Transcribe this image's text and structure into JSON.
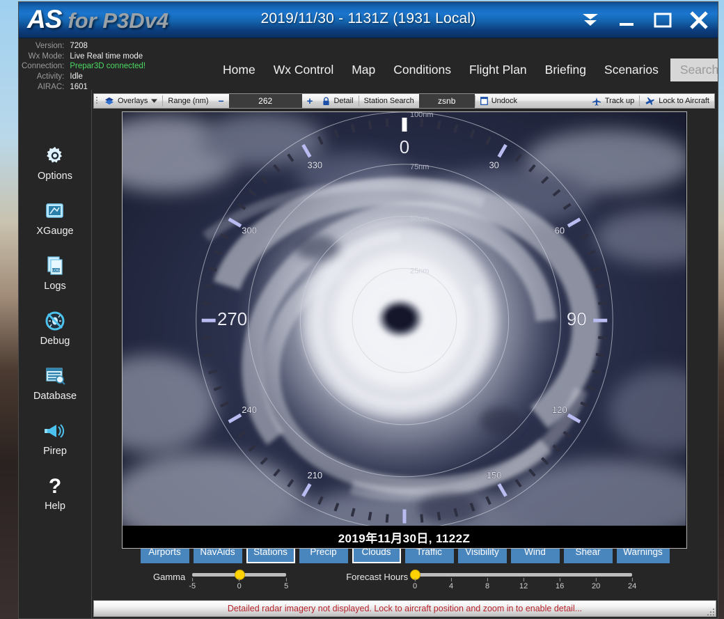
{
  "titlebar": {
    "logo_primary": "AS",
    "logo_secondary": "for P3Dv4",
    "datetime": "2019/11/30 - 1131Z (1931 Local)",
    "buttons": [
      "collapse-button",
      "minimize-button",
      "maximize-button",
      "close-button"
    ]
  },
  "status_info": [
    {
      "label": "Version:",
      "value": "7208",
      "state": "normal"
    },
    {
      "label": "Wx Mode:",
      "value": "Live Real time mode",
      "state": "normal"
    },
    {
      "label": "Connection:",
      "value": "Prepar3D connected!",
      "state": "ok"
    },
    {
      "label": "Activity:",
      "value": "Idle",
      "state": "normal"
    },
    {
      "label": "AIRAC:",
      "value": "1601",
      "state": "normal"
    }
  ],
  "nav": {
    "items": [
      "Home",
      "Wx Control",
      "Map",
      "Conditions",
      "Flight Plan",
      "Briefing",
      "Scenarios"
    ],
    "search_label": "Search"
  },
  "sidebar": {
    "items": [
      {
        "label": "Options",
        "icon": "gear-icon"
      },
      {
        "label": "XGauge",
        "icon": "gauge-icon"
      },
      {
        "label": "Logs",
        "icon": "log-document-icon"
      },
      {
        "label": "Debug",
        "icon": "debug-bug-icon"
      },
      {
        "label": "Database",
        "icon": "database-icon"
      },
      {
        "label": "Pirep",
        "icon": "megaphone-icon"
      },
      {
        "label": "Help",
        "icon": "question-mark-icon"
      }
    ]
  },
  "map_toolbar": {
    "overlays_label": "Overlays",
    "range_label": "Range (nm)",
    "range_value": "262",
    "detail_label": "Detail",
    "station_search_label": "Station Search",
    "station_value": "zsnb",
    "undock_label": "Undock",
    "track_up_label": "Track up",
    "lock_to_aircraft_label": "Lock to Aircraft",
    "zoom_out_symbol": "−",
    "zoom_in_symbol": "+"
  },
  "radar": {
    "caption": "2019年11月30日, 1122Z",
    "heading_marker_deg": 0,
    "compass_labels": [
      {
        "deg": 0,
        "text": "0",
        "size": "large"
      },
      {
        "deg": 30,
        "text": "30",
        "size": "small"
      },
      {
        "deg": 60,
        "text": "60",
        "size": "small"
      },
      {
        "deg": 90,
        "text": "90",
        "size": "large"
      },
      {
        "deg": 120,
        "text": "120",
        "size": "small"
      },
      {
        "deg": 150,
        "text": "150",
        "size": "small"
      },
      {
        "deg": 210,
        "text": "210",
        "size": "small"
      },
      {
        "deg": 240,
        "text": "240",
        "size": "small"
      },
      {
        "deg": 270,
        "text": "270",
        "size": "large"
      },
      {
        "deg": 300,
        "text": "300",
        "size": "small"
      },
      {
        "deg": 330,
        "text": "330",
        "size": "small"
      }
    ],
    "range_rings": [
      "25nm",
      "50nm",
      "75nm",
      "100nm"
    ]
  },
  "layer_buttons": [
    {
      "label": "Airports",
      "active": false
    },
    {
      "label": "NavAids",
      "active": false
    },
    {
      "label": "Stations",
      "active": true
    },
    {
      "label": "Precip",
      "active": false
    },
    {
      "label": "Clouds",
      "active": true
    },
    {
      "label": "Traffic",
      "active": false
    },
    {
      "label": "Visibility",
      "active": false
    },
    {
      "label": "Wind",
      "active": false
    },
    {
      "label": "Shear",
      "active": false
    },
    {
      "label": "Warnings",
      "active": false
    }
  ],
  "sliders": {
    "gamma": {
      "label": "Gamma",
      "value": 0,
      "min": -5,
      "max": 5,
      "ticks": [
        "-5",
        "0",
        "5"
      ]
    },
    "forecast_hours": {
      "label": "Forecast Hours",
      "value": 0,
      "min": 0,
      "max": 24,
      "ticks": [
        "0",
        "4",
        "8",
        "12",
        "16",
        "20",
        "24"
      ]
    }
  },
  "status_bar": {
    "message": "Detailed radar imagery not displayed. Lock to aircraft position and zoom in to enable detail..."
  },
  "colors": {
    "accent_blue": "#1b76cf",
    "layer_button": "#4a86be",
    "status_ok": "#4cd964",
    "status_warning": "#b4222a",
    "slider_knob": "#ffd200"
  }
}
